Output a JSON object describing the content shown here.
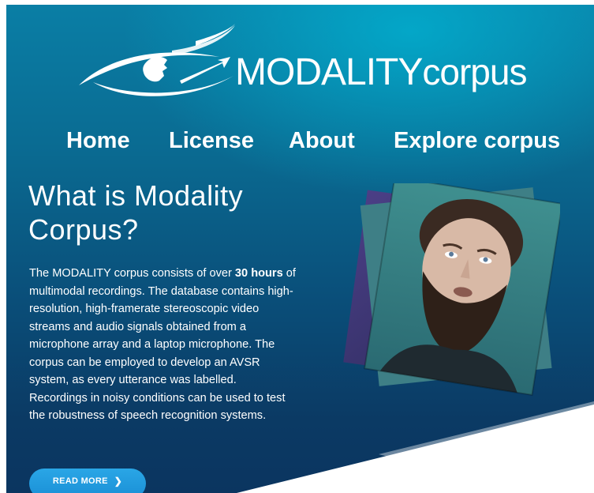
{
  "brand": {
    "name_upper": "MODALITY",
    "name_lower": "corpus"
  },
  "nav": {
    "items": [
      {
        "label": "Home"
      },
      {
        "label": "License"
      },
      {
        "label": "About"
      },
      {
        "label": "Explore corpus"
      }
    ]
  },
  "hero": {
    "headline_line1": "What is Modality",
    "headline_line2": "Corpus?",
    "intro_before_bold": "The MODALITY corpus consists of over ",
    "intro_bold": "30 hours",
    "intro_after_bold": " of multimodal recordings. The database contains high-resolution, high-framerate stereoscopic video streams and audio signals obtained from a microphone array and a laptop microphone. The corpus can be employed to develop an AVSR system, as every utterance was labelled. Recordings in noisy conditions can be used to test the robustness of speech recognition systems.",
    "read_more_label": "READ MORE",
    "read_more_icon": "chevron-right-icon"
  },
  "colors": {
    "bg_top": "#0a7fa6",
    "bg_bottom": "#0b3560",
    "button": "#1a8fd6",
    "text": "#ffffff"
  }
}
